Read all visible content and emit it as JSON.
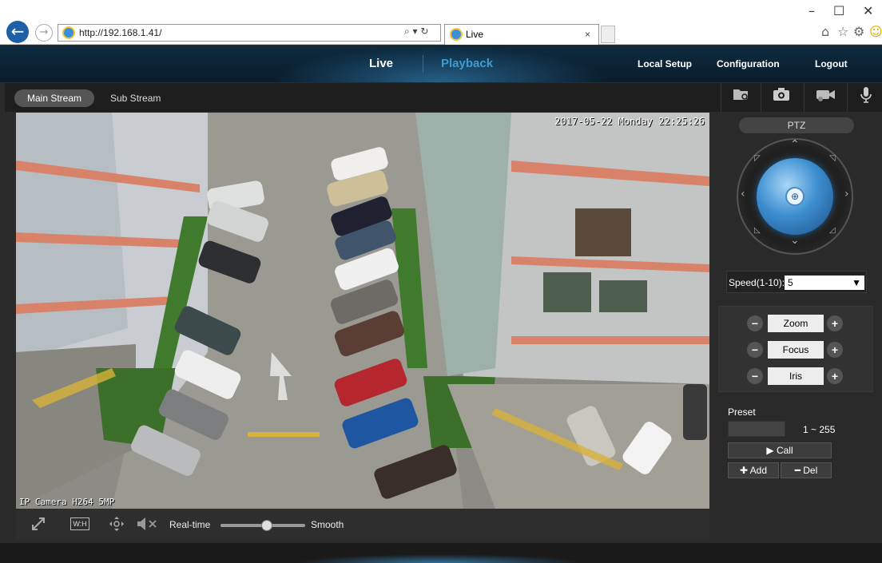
{
  "browser": {
    "url": "http://192.168.1.41/",
    "tab_title": "Live",
    "tab_close": "×",
    "window_controls": {
      "minimize": "–",
      "maximize": "☐",
      "close": "✕"
    },
    "address_actions": "⌕ ▾ ↻",
    "toolbar_icons": {
      "home": "⌂",
      "favorites": "☆",
      "settings": "⚙",
      "smiley": "☺"
    }
  },
  "app": {
    "nav": {
      "live": "Live",
      "playback": "Playback",
      "local_setup": "Local Setup",
      "configuration": "Configuration",
      "logout": "Logout"
    },
    "streams": {
      "main": "Main Stream",
      "sub": "Sub Stream"
    },
    "toolbar_icons": [
      "folder-search-icon",
      "camera-snapshot-icon",
      "record-icon",
      "microphone-icon"
    ],
    "video": {
      "osd_time": "2017-05-22 Monday 22:25:26",
      "osd_name": "IP Camera H264 5MP"
    },
    "bottom_bar": {
      "wh_label": "W:H",
      "realtime": "Real-time",
      "smooth": "Smooth",
      "stream_quality_level": 0.55
    },
    "ptz": {
      "tab": "PTZ",
      "center_icon": "⊕",
      "speed_label": "Speed(1-10):",
      "speed_value": "5",
      "lens": [
        {
          "label": "Zoom"
        },
        {
          "label": "Focus"
        },
        {
          "label": "Iris"
        }
      ],
      "minus": "−",
      "plus": "+",
      "preset_title": "Preset",
      "preset_range": "1 ~ 255",
      "call": "▶ Call",
      "add": "✚ Add",
      "del": "━ Del"
    }
  }
}
